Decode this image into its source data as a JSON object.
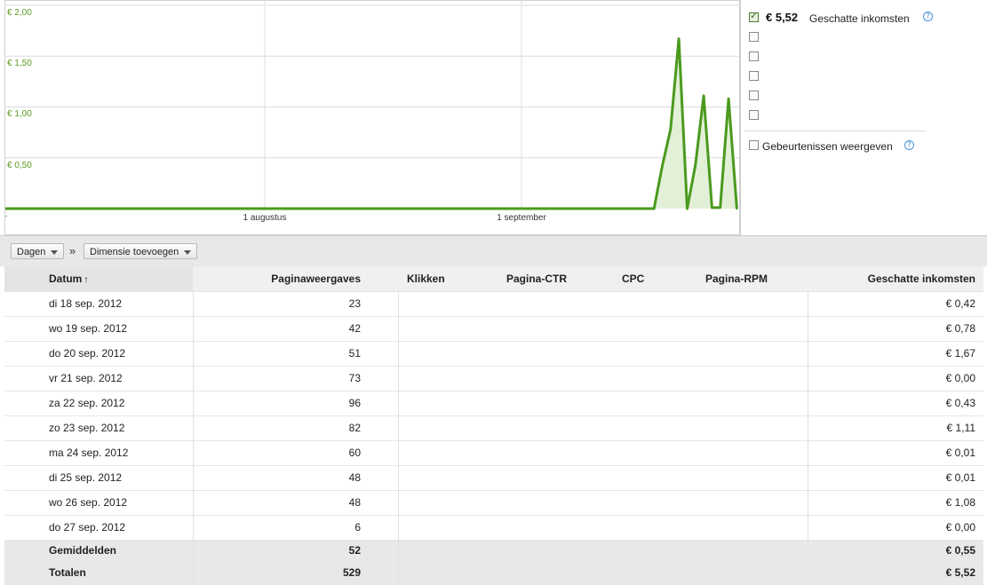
{
  "chart": {
    "y_ticks": [
      "€ 2,00",
      "€ 1,50",
      "€ 1,00",
      "€ 0,50"
    ],
    "x_labels": [
      "1 augustus",
      "1 september"
    ],
    "origin_label": ".",
    "line_color": "#4a9a1e",
    "fill_color": "#e3f0d8"
  },
  "chart_data": {
    "type": "area",
    "series": [
      {
        "name": "Geschatte inkomsten",
        "x": [
          "2012-07-01",
          "2012-09-16",
          "2012-09-17",
          "2012-09-18",
          "2012-09-19",
          "2012-09-20",
          "2012-09-21",
          "2012-09-22",
          "2012-09-23",
          "2012-09-24",
          "2012-09-25",
          "2012-09-26",
          "2012-09-27"
        ],
        "values": [
          0,
          0,
          0,
          0.42,
          0.78,
          1.67,
          0.0,
          0.43,
          1.11,
          0.01,
          0.01,
          1.08,
          0.0
        ]
      }
    ],
    "xlabel": "",
    "ylabel": "",
    "ylim": [
      0,
      2.0
    ],
    "grid": true
  },
  "legend": {
    "value": "€ 5,52",
    "label": "Geschatte inkomsten",
    "events_label": "Gebeurtenissen weergeven"
  },
  "toolbar": {
    "days_label": "Dagen",
    "chevron": "»",
    "dimension_label": "Dimensie toevoegen"
  },
  "table": {
    "headers": {
      "date": "Datum",
      "sort_icon": "↑",
      "views": "Paginaweergaves",
      "clicks": "Klikken",
      "ctr": "Pagina-CTR",
      "cpc": "CPC",
      "rpm": "Pagina-RPM",
      "income": "Geschatte inkomsten"
    },
    "rows": [
      {
        "date": "di 18 sep. 2012",
        "views": "23",
        "income": "€ 0,42"
      },
      {
        "date": "wo 19 sep. 2012",
        "views": "42",
        "income": "€ 0,78"
      },
      {
        "date": "do 20 sep. 2012",
        "views": "51",
        "income": "€ 1,67"
      },
      {
        "date": "vr 21 sep. 2012",
        "views": "73",
        "income": "€ 0,00"
      },
      {
        "date": "za 22 sep. 2012",
        "views": "96",
        "income": "€ 0,43"
      },
      {
        "date": "zo 23 sep. 2012",
        "views": "82",
        "income": "€ 1,11"
      },
      {
        "date": "ma 24 sep. 2012",
        "views": "60",
        "income": "€ 0,01"
      },
      {
        "date": "di 25 sep. 2012",
        "views": "48",
        "income": "€ 0,01"
      },
      {
        "date": "wo 26 sep. 2012",
        "views": "48",
        "income": "€ 1,08"
      },
      {
        "date": "do 27 sep. 2012",
        "views": "6",
        "income": "€ 0,00"
      }
    ],
    "averages": {
      "label": "Gemiddelden",
      "views": "52",
      "income": "€ 0,55"
    },
    "totals": {
      "label": "Totalen",
      "views": "529",
      "income": "€ 5,52"
    }
  }
}
